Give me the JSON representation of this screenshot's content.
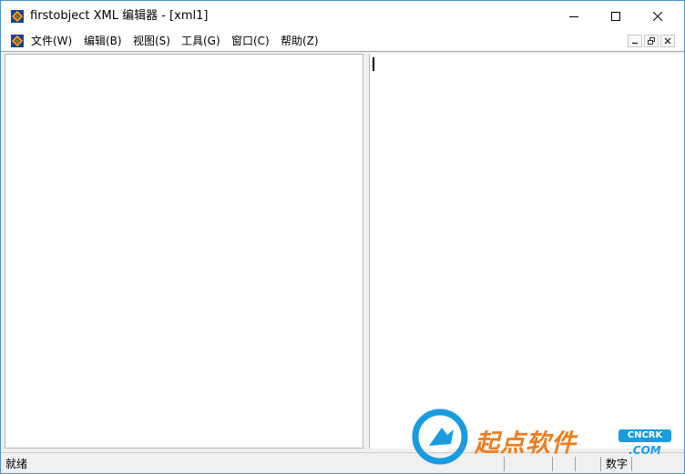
{
  "window": {
    "title": "firstobject XML 编辑器 - [xml1]",
    "app_icon": "app-icon",
    "controls": [
      "minimize-icon",
      "maximize-icon",
      "close-icon"
    ]
  },
  "menubar": {
    "items": [
      {
        "label": "文件(W)"
      },
      {
        "label": "编辑(B)"
      },
      {
        "label": "视图(S)"
      },
      {
        "label": "工具(G)"
      },
      {
        "label": "窗口(C)"
      },
      {
        "label": "帮助(Z)"
      }
    ],
    "mdi_controls": [
      "mdi-minimize-icon",
      "mdi-restore-icon",
      "mdi-close-icon"
    ]
  },
  "editor": {
    "left_pane": "",
    "right_pane": ""
  },
  "statusbar": {
    "text": "就绪",
    "num_indicator": "数字"
  },
  "watermark": {
    "brand": "起点软件",
    "badge_top": "CNCRK",
    "badge_bottom": ".COM"
  },
  "colors": {
    "window_border": "#4a90d9",
    "watermark_orange": "#ef7d1e",
    "watermark_blue": "#1a9be0"
  }
}
